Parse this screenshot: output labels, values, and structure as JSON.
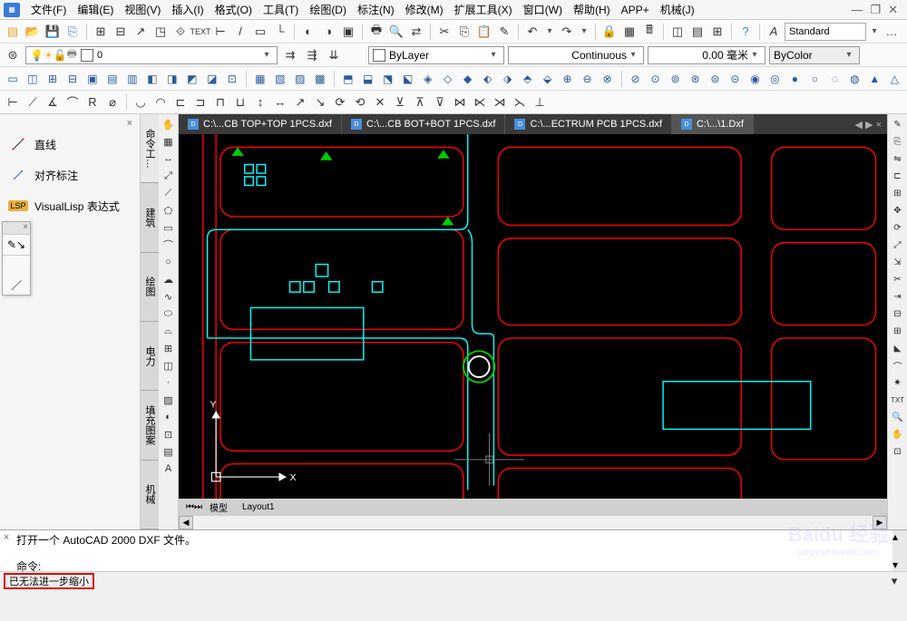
{
  "menu": {
    "items": [
      "文件(F)",
      "编辑(E)",
      "视图(V)",
      "插入(I)",
      "格式(O)",
      "工具(T)",
      "绘图(D)",
      "标注(N)",
      "修改(M)",
      "扩展工具(X)",
      "窗口(W)",
      "帮助(H)",
      "APP+",
      "机械(J)"
    ]
  },
  "win_controls": {
    "min": "—",
    "restore": "❐",
    "close": "✕"
  },
  "toolbar1": {
    "style_label": "Standard"
  },
  "layer_row": {
    "layer_value": "0",
    "bylayer": "ByLayer",
    "linetype": "Continuous",
    "lineweight": "0.00 毫米",
    "bycolor": "ByColor"
  },
  "left_panel": {
    "items": [
      {
        "label": "直线"
      },
      {
        "label": "对齐标注"
      },
      {
        "label": "VisualLisp 表达式"
      }
    ]
  },
  "side_tabs": [
    "命令工…",
    "建筑",
    "绘图",
    "电力",
    "填充图案",
    "机械"
  ],
  "doc_tabs": [
    {
      "label": "C:\\...CB TOP+TOP 1PCS.dxf",
      "active": false
    },
    {
      "label": "C:\\...CB BOT+BOT 1PCS.dxf",
      "active": false
    },
    {
      "label": "C:\\...ECTRUM PCB 1PCS.dxf",
      "active": false
    },
    {
      "label": "C:\\...\\1.Dxf",
      "active": true
    }
  ],
  "layout_tabs": {
    "model": "模型",
    "layout1": "Layout1"
  },
  "axis": {
    "x": "X",
    "y": "Y"
  },
  "cmd": {
    "line1": "打开一个 AutoCAD 2000 DXF 文件。",
    "prompt": "命令:"
  },
  "status": {
    "msg": "已无法进一步缩小"
  },
  "watermark": {
    "brand": "Baidu 经验",
    "sub": "jingyan.baidu.com"
  }
}
